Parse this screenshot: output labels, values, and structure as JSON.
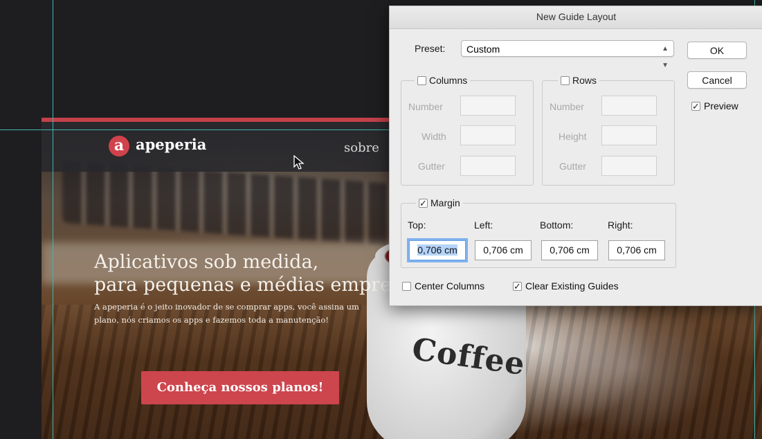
{
  "dialog": {
    "title": "New Guide Layout",
    "preset_label": "Preset:",
    "preset_value": "Custom",
    "ok_label": "OK",
    "cancel_label": "Cancel",
    "preview_label": "Preview",
    "preview_checked": true,
    "columns": {
      "label": "Columns",
      "checked": false,
      "number_label": "Number",
      "width_label": "Width",
      "gutter_label": "Gutter"
    },
    "rows": {
      "label": "Rows",
      "checked": false,
      "number_label": "Number",
      "height_label": "Height",
      "gutter_label": "Gutter"
    },
    "margin": {
      "label": "Margin",
      "checked": true,
      "top_label": "Top:",
      "left_label": "Left:",
      "bottom_label": "Bottom:",
      "right_label": "Right:",
      "top_value": "0,706 cm",
      "left_value": "0,706 cm",
      "bottom_value": "0,706 cm",
      "right_value": "0,706 cm"
    },
    "center_columns_label": "Center Columns",
    "center_columns_checked": false,
    "clear_guides_label": "Clear Existing Guides",
    "clear_guides_checked": true
  },
  "website": {
    "logo_letter": "a",
    "brand": "apeperia",
    "nav_link": "sobre",
    "hero_line1": "Aplicativos sob medida,",
    "hero_line2": "para pequenas e médias empresas.",
    "hero_sub_line1": "A apeperia é o jeito inovador de se comprar apps, você assina um",
    "hero_sub_line2": "plano, nós criamos os apps e fazemos toda a manutenção!",
    "cta_label": "Conheça nossos planos!",
    "mug_text": "Coffee",
    "accent_color": "#cd454d"
  },
  "guide_color": "#3fb7b0"
}
